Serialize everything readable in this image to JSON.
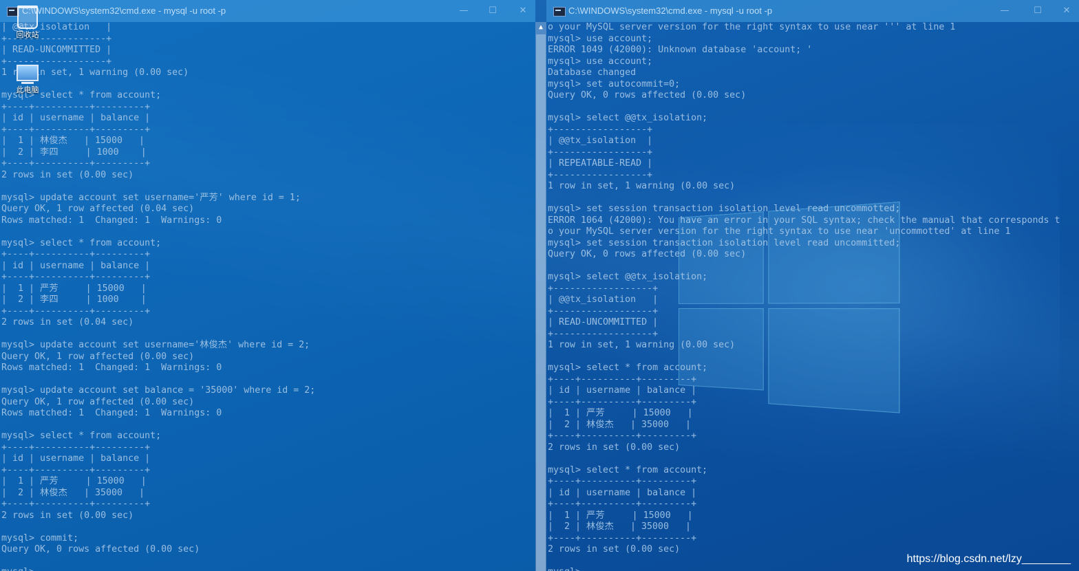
{
  "windows": {
    "left": {
      "title": "C:\\WINDOWS\\system32\\cmd.exe - mysql  -u root -p",
      "lines": [
        "| @@tx_isolation   |",
        "+------------------+",
        "| READ-UNCOMMITTED |",
        "+------------------+",
        "1 row in set, 1 warning (0.00 sec)",
        "",
        "mysql> select * from account;",
        "+----+----------+---------+",
        "| id | username | balance |",
        "+----+----------+---------+",
        "|  1 | 林俊杰   | 15000   |",
        "|  2 | 李四     | 1000    |",
        "+----+----------+---------+",
        "2 rows in set (0.00 sec)",
        "",
        "mysql> update account set username='严芳' where id = 1;",
        "Query OK, 1 row affected (0.04 sec)",
        "Rows matched: 1  Changed: 1  Warnings: 0",
        "",
        "mysql> select * from account;",
        "+----+----------+---------+",
        "| id | username | balance |",
        "+----+----------+---------+",
        "|  1 | 严芳     | 15000   |",
        "|  2 | 李四     | 1000    |",
        "+----+----------+---------+",
        "2 rows in set (0.04 sec)",
        "",
        "mysql> update account set username='林俊杰' where id = 2;",
        "Query OK, 1 row affected (0.00 sec)",
        "Rows matched: 1  Changed: 1  Warnings: 0",
        "",
        "mysql> update account set balance = '35000' where id = 2;",
        "Query OK, 1 row affected (0.00 sec)",
        "Rows matched: 1  Changed: 1  Warnings: 0",
        "",
        "mysql> select * from account;",
        "+----+----------+---------+",
        "| id | username | balance |",
        "+----+----------+---------+",
        "|  1 | 严芳     | 15000   |",
        "|  2 | 林俊杰   | 35000   |",
        "+----+----------+---------+",
        "2 rows in set (0.00 sec)",
        "",
        "mysql> commit;",
        "Query OK, 0 rows affected (0.00 sec)",
        "",
        "mysql> _"
      ]
    },
    "right": {
      "title": "C:\\WINDOWS\\system32\\cmd.exe - mysql  -u root -p",
      "lines": [
        "o your MySQL server version for the right syntax to use near ''' at line 1",
        "mysql> use account;",
        "ERROR 1049 (42000): Unknown database 'account; '",
        "mysql> use account;",
        "Database changed",
        "mysql> set autocommit=0;",
        "Query OK, 0 rows affected (0.00 sec)",
        "",
        "mysql> select @@tx_isolation;",
        "+-----------------+",
        "| @@tx_isolation  |",
        "+-----------------+",
        "| REPEATABLE-READ |",
        "+-----------------+",
        "1 row in set, 1 warning (0.00 sec)",
        "",
        "mysql> set session transaction isolation level read uncommotted;",
        "ERROR 1064 (42000): You have an error in your SQL syntax; check the manual that corresponds t",
        "o your MySQL server version for the right syntax to use near 'uncommotted' at line 1",
        "mysql> set session transaction isolation level read uncommitted;",
        "Query OK, 0 rows affected (0.00 sec)",
        "",
        "mysql> select @@tx_isolation;",
        "+------------------+",
        "| @@tx_isolation   |",
        "+------------------+",
        "| READ-UNCOMMITTED |",
        "+------------------+",
        "1 row in set, 1 warning (0.00 sec)",
        "",
        "mysql> select * from account;",
        "+----+----------+---------+",
        "| id | username | balance |",
        "+----+----------+---------+",
        "|  1 | 严芳     | 15000   |",
        "|  2 | 林俊杰   | 35000   |",
        "+----+----------+---------+",
        "2 rows in set (0.00 sec)",
        "",
        "mysql> select * from account;",
        "+----+----------+---------+",
        "| id | username | balance |",
        "+----+----------+---------+",
        "|  1 | 严芳     | 15000   |",
        "|  2 | 林俊杰   | 35000   |",
        "+----+----------+---------+",
        "2 rows in set (0.00 sec)",
        "",
        "mysql> _"
      ]
    },
    "buttons": {
      "minimize": "—",
      "maximize": "☐",
      "close": "✕"
    }
  },
  "desktop": {
    "recycle_bin_label": "回收站",
    "this_pc_label": "此电脑"
  },
  "watermark": "https://blog.csdn.net/lzy________",
  "colors": {
    "desktop": "#1560ad",
    "terminal_text": "#a9c8e6"
  }
}
